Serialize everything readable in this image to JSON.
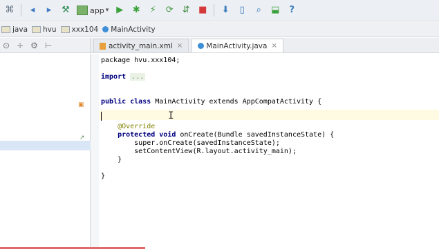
{
  "toolbar": {
    "run_config_label": "app",
    "icons": [
      "project-structure-icon",
      "back-icon",
      "forward-icon",
      "make-icon",
      "run-config-combo",
      "run-icon",
      "debug-icon",
      "profile-icon",
      "apply-changes-icon",
      "sync-icon",
      "stop-icon",
      "sdk-manager-icon",
      "avd-manager-icon",
      "search-icon",
      "help-icon"
    ]
  },
  "breadcrumb": {
    "items": [
      "java",
      "hvu",
      "xxx104",
      "MainActivity"
    ]
  },
  "tabs": [
    {
      "label": "activity_main.xml",
      "active": false
    },
    {
      "label": "MainActivity.java",
      "active": true
    }
  ],
  "editor": {
    "lines": [
      {
        "text": "package hvu.xxx104;"
      },
      {
        "text": ""
      },
      {
        "kw": "import",
        "folded": "..."
      },
      {
        "text": ""
      },
      {
        "text": ""
      },
      {
        "kw": "public class ",
        "text": "MainActivity extends AppCompatActivity {"
      },
      {
        "text": ""
      },
      {
        "text": ""
      },
      {
        "ann": "    @Override"
      },
      {
        "kw": "    protected void ",
        "text": "onCreate(Bundle savedInstanceState) {"
      },
      {
        "text": "        super.onCreate(savedInstanceState);"
      },
      {
        "text": "        setContentView(R.layout.activity_main);"
      },
      {
        "text": "    }"
      },
      {
        "text": ""
      },
      {
        "text": "}"
      }
    ]
  },
  "colors": {
    "current_line_bg": "#fffbe3",
    "keyword": "#000080",
    "annotation": "#808000"
  }
}
